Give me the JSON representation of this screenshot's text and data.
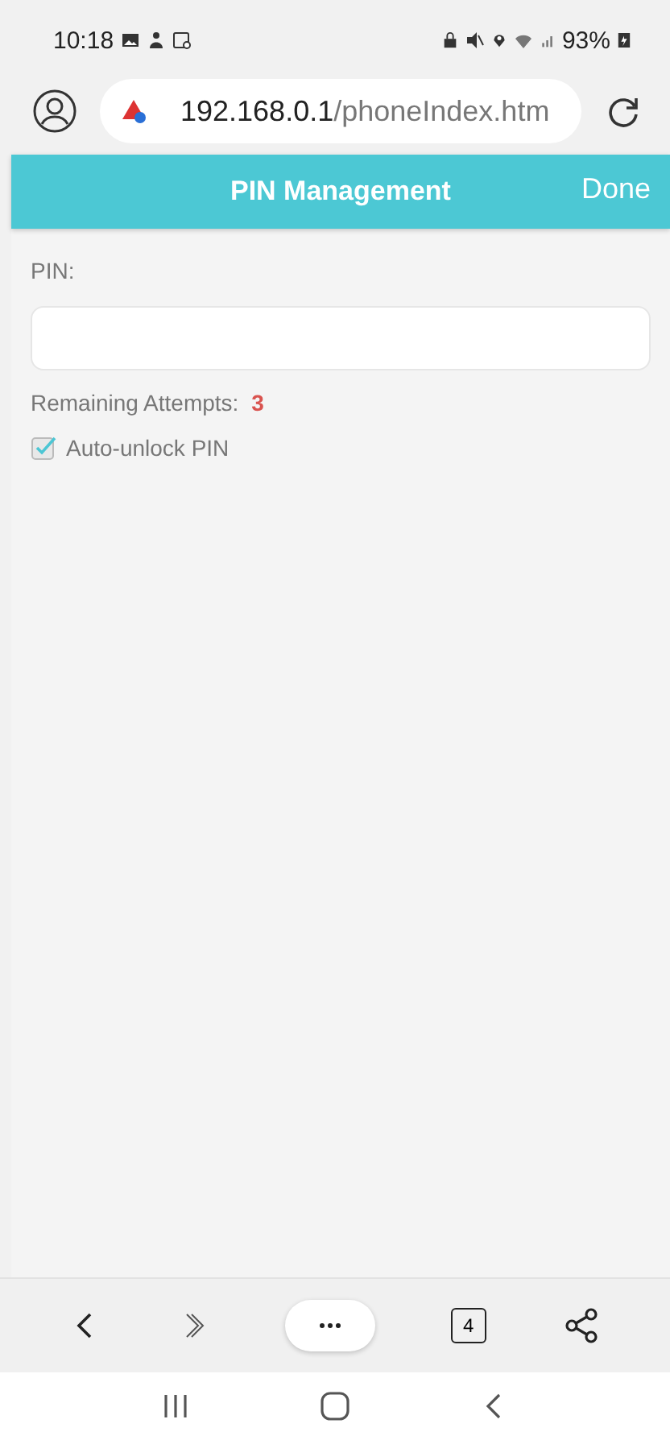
{
  "status_bar": {
    "time": "10:18",
    "battery": "93%"
  },
  "browser": {
    "url_host": "192.168.0.1",
    "url_path": "/phoneIndex.htm",
    "tab_count": "4"
  },
  "header": {
    "title": "PIN Management",
    "done": "Done"
  },
  "form": {
    "pin_label": "PIN:",
    "attempts_label": "Remaining Attempts:",
    "attempts_value": "3",
    "auto_unlock": {
      "label": "Auto-unlock PIN",
      "checked": true
    }
  }
}
